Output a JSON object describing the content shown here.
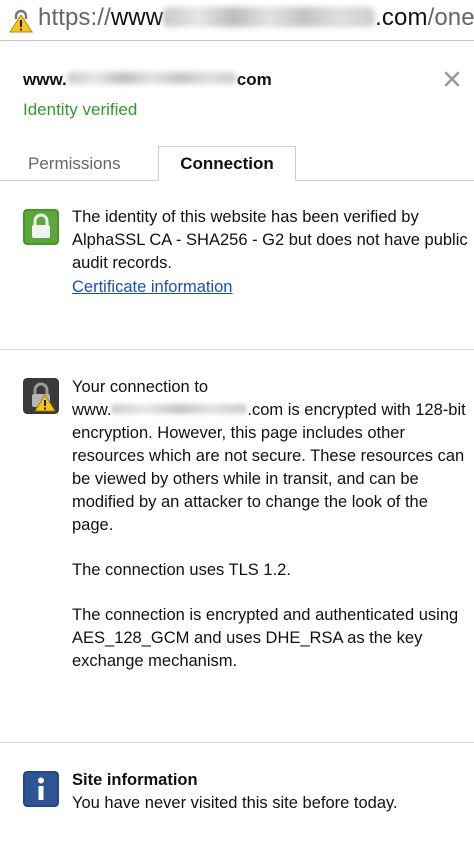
{
  "url_bar": {
    "prefix": "https://",
    "host_start": "www",
    "host_end": ".com",
    "path": "/onepa"
  },
  "header": {
    "host_start": "www.",
    "host_end": "com",
    "identity_status": "Identity verified"
  },
  "tabs": [
    {
      "label": "Permissions",
      "active": false
    },
    {
      "label": "Connection",
      "active": true
    }
  ],
  "identity_section": {
    "text": "The identity of this website has been verified by AlphaSSL CA - SHA256 - G2 but does not have public audit records.",
    "link": "Certificate information"
  },
  "connection_section": {
    "intro_start": "Your connection to",
    "host_start": "www.",
    "host_end": ".com",
    "intro_rest": " is encrypted with 128-bit encryption. However, this page includes other resources which are not secure. These resources can be viewed by others while in transit, and can be modified by an attacker to change the look of the page.",
    "tls": "The connection uses TLS 1.2.",
    "cipher": "The connection is encrypted and authenticated using AES_128_GCM and uses DHE_RSA as the key exchange mechanism."
  },
  "site_info": {
    "title": "Site information",
    "text": "You have never visited this site before today."
  },
  "colors": {
    "verified": "#2f9a2f",
    "link": "#1a4fb4",
    "lock_green": "#5aa83a",
    "info_blue": "#2f5597"
  }
}
